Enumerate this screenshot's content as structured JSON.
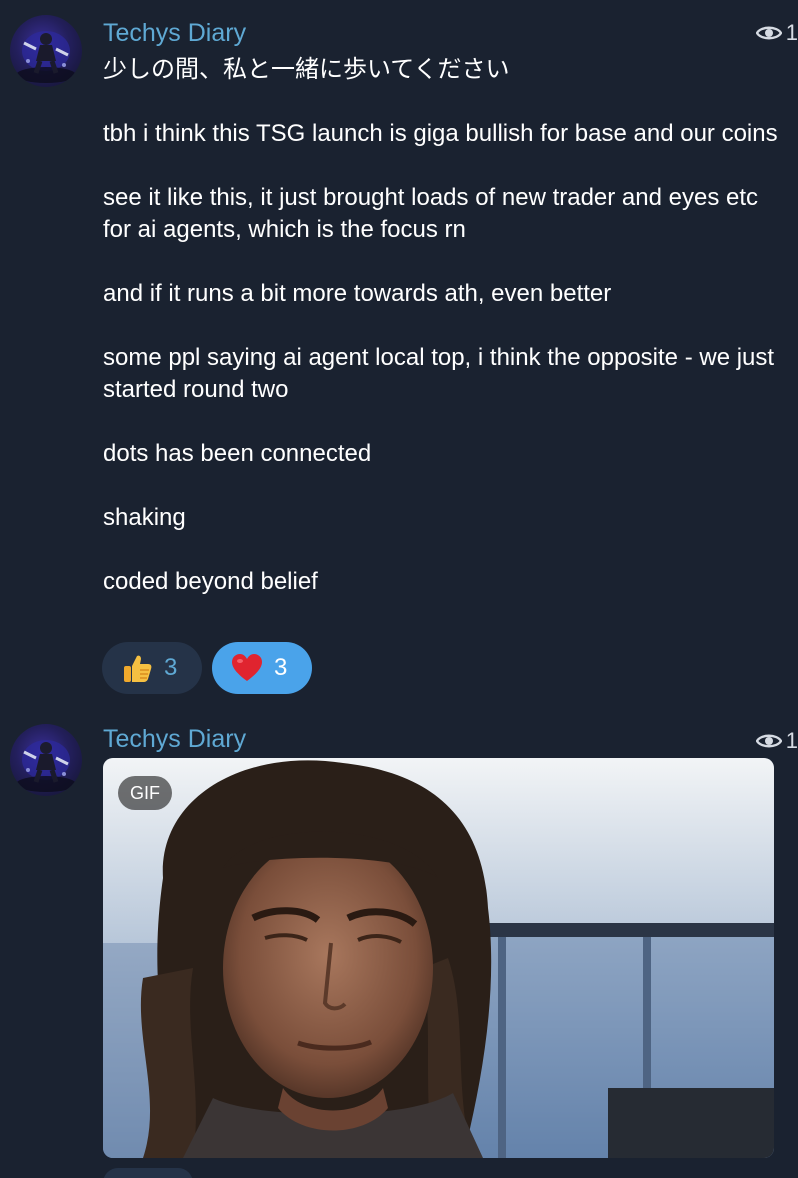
{
  "posts": [
    {
      "author": "Techys Diary",
      "views": "1",
      "avatar_icon": "ninja-avatar",
      "paragraphs": [
        "少しの間、私と一緒に歩いてください",
        "tbh i think this TSG launch is giga bullish for base and our coins",
        "see it like this, it just brought loads of new trader and eyes etc for ai agents, which is the focus rn",
        "and if it runs a bit more towards ath, even better",
        "some ppl saying ai agent local top, i think the opposite - we just started round two",
        "dots has been connected",
        "shaking",
        "coded beyond belief"
      ],
      "reactions": [
        {
          "emoji": "thumbs-up-icon",
          "count": "3",
          "selected": false
        },
        {
          "emoji": "red-heart-icon",
          "count": "3",
          "selected": true
        }
      ]
    },
    {
      "author": "Techys Diary",
      "views": "1",
      "avatar_icon": "ninja-avatar",
      "media": {
        "badge": "GIF",
        "description_icon": "gif-man-long-hair"
      }
    }
  ],
  "colors": {
    "background": "#1a2230",
    "author": "#5fa9d4",
    "reaction_plain": "#253348",
    "reaction_selected": "#4aa3ea"
  }
}
